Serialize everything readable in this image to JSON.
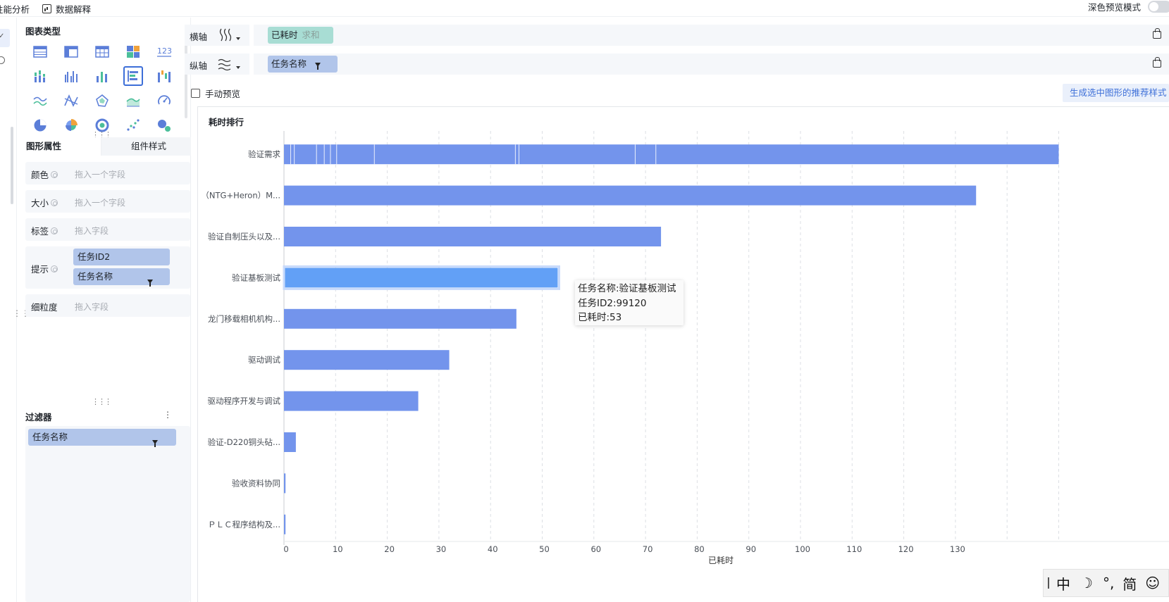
{
  "topbar": {
    "tab_perf": "性能分析",
    "tab_data_explain": "数据解释",
    "dark_preview_label": "深色预览模式"
  },
  "chart_types": {
    "title": "图表类型",
    "number_icon_text": "123"
  },
  "attr_tabs": {
    "shape_attr": "图形属性",
    "component_style": "组件样式"
  },
  "attrs": {
    "color_label": "颜色",
    "color_placeholder": "拖入一个字段",
    "size_label": "大小",
    "size_placeholder": "拖入一个字段",
    "tag_label": "标签",
    "tag_placeholder": "拖入字段",
    "tip_label": "提示",
    "tip_fields": [
      "任务ID2",
      "任务名称"
    ],
    "granularity_label": "细粒度",
    "granularity_placeholder": "拖入字段"
  },
  "filter": {
    "title": "过滤器",
    "field": "任务名称"
  },
  "axes": {
    "x_label": "横轴",
    "x_field": "已耗时",
    "x_agg": "求和",
    "y_label": "纵轴",
    "y_field": "任务名称"
  },
  "manual_preview_label": "手动预览",
  "generate_button": "生成选中图形的推荐样式",
  "chart_title": "耗时排行",
  "colors": {
    "bar": "#7394ec",
    "bar_highlight": "#62a0f6",
    "x_pill": "#a8ddd4",
    "y_pill": "#b1c5ea",
    "accent": "#3d6fd8"
  },
  "chart_data": {
    "type": "bar",
    "orientation": "horizontal",
    "categories": [
      "验证需求",
      "（NTG+Heron）M...",
      "验证自制压头以及...",
      "验证基板测试",
      "龙门移载相机机构...",
      "驱动调试",
      "驱动程序开发与调试",
      "验证-D220铜头砧...",
      "验收资料协同",
      "ＰＬＣ程序结构及..."
    ],
    "values": [
      150,
      134,
      73,
      53,
      45,
      32,
      26,
      2.3,
      0.3,
      0.3
    ],
    "xlabel": "已耗时",
    "xlim": [
      0,
      150
    ],
    "xticks": [
      0,
      10,
      20,
      30,
      40,
      50,
      60,
      70,
      80,
      90,
      100,
      110,
      120,
      130
    ],
    "grid": "vertical-dashed",
    "highlight_index": 3,
    "first_bar_segments": [
      1.3,
      2.0,
      6.3,
      7.8,
      9.0,
      10.2,
      17.5,
      44.8,
      45.5,
      68,
      72
    ]
  },
  "tooltip": {
    "line1": "任务名称:验证基板测试",
    "line2": "任务ID2:99120",
    "line3": "已耗时:53"
  },
  "ime": {
    "lang": "中",
    "moon": "☽",
    "punct": "°,",
    "mode": "简",
    "emoji": "☺"
  }
}
